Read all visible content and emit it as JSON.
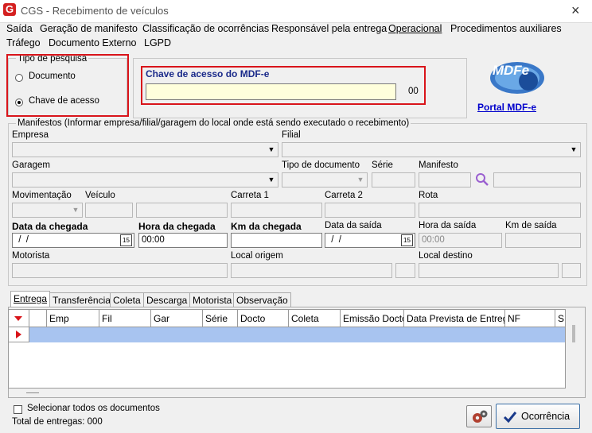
{
  "window": {
    "title": "CGS - Recebimento de veículos"
  },
  "menu": [
    {
      "label": "Saída"
    },
    {
      "label": "Geração de manifesto"
    },
    {
      "label": "Classificação de ocorrências"
    },
    {
      "label": "Responsável pela entrega"
    },
    {
      "label": "Operacional"
    },
    {
      "label": "Procedimentos auxiliares"
    },
    {
      "label": "Tráfego"
    },
    {
      "label": "Documento Externo"
    },
    {
      "label": "LGPD"
    }
  ],
  "search_type": {
    "legend": "Tipo de pesquisa",
    "options": [
      {
        "label": "Documento",
        "selected": false
      },
      {
        "label": "Chave de acesso",
        "selected": true
      }
    ]
  },
  "access_key": {
    "label": "Chave de acesso do MDF-e",
    "value": "",
    "counter": "00"
  },
  "portal": {
    "logo_text": "MDFe",
    "link": "Portal MDF-e"
  },
  "manifests": {
    "legend": "Manifestos (Informar empresa/filial/garagem do local onde está sendo executado o recebimento)",
    "empresa": "Empresa",
    "filial": "Filial",
    "garagem": "Garagem",
    "tipo_documento": "Tipo de documento",
    "serie": "Série",
    "manifesto": "Manifesto",
    "movimentacao": "Movimentação",
    "veiculo": "Veículo",
    "carreta1": "Carreta 1",
    "carreta2": "Carreta 2",
    "rota": "Rota",
    "data_chegada": {
      "label": "Data da chegada",
      "value": " /  /"
    },
    "hora_chegada": {
      "label": "Hora da chegada",
      "value": "00:00"
    },
    "km_chegada": {
      "label": "Km da chegada",
      "value": ""
    },
    "data_saida": {
      "label": "Data da saída",
      "value": " /  /"
    },
    "hora_saida": {
      "label": "Hora da saída",
      "value": "00:00"
    },
    "km_saida": {
      "label": "Km de saída",
      "value": ""
    },
    "motorista": "Motorista",
    "local_origem": "Local origem",
    "local_destino": "Local destino",
    "calendar_glyph": "15"
  },
  "tabs": [
    "Entrega",
    "Transferência",
    "Coleta",
    "Descarga",
    "Motorista",
    "Observação"
  ],
  "grid": {
    "columns": [
      "Emp",
      "Fil",
      "Gar",
      "Série",
      "Docto",
      "Coleta",
      "Emissão Docto",
      "Data Prevista de Entrega",
      "NF",
      "S"
    ]
  },
  "footer": {
    "select_all": "Selecionar todos os documentos",
    "total": "Total de entregas: 000",
    "ocorrencia": "Ocorrência"
  },
  "colors": {
    "accent": "#d9141a",
    "link": "#0000cc",
    "selection": "#a8c4f0",
    "yellow": "#ffffdc"
  }
}
